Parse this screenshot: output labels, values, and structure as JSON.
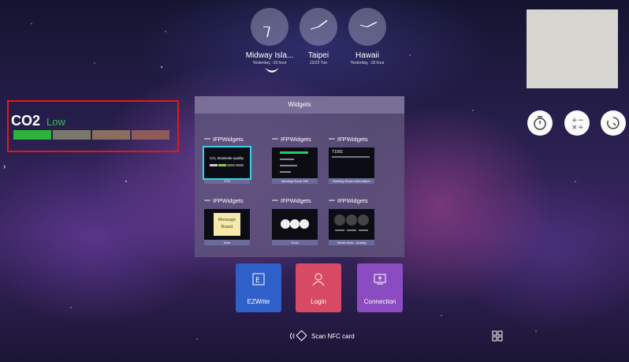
{
  "clocks": [
    {
      "city": "Midway Isla...",
      "sub": "Yesterday, -19 hour"
    },
    {
      "city": "Taipei",
      "sub": "12/22 Tue"
    },
    {
      "city": "Hawaii",
      "sub": "Yesterday, -18 hour"
    }
  ],
  "co2_widget": {
    "title": "CO2",
    "level": "Low",
    "level_color": "#35c24a"
  },
  "widgets_panel": {
    "title": "Widgets",
    "items": [
      {
        "source": "IFPWidgets",
        "caption": "CO2",
        "preview_text": "CO₂ Moderate quality"
      },
      {
        "source": "IFPWidgets",
        "caption": "Meeting Room 365"
      },
      {
        "source": "IFPWidgets",
        "caption": "Meeting Room Information",
        "preview_text": "T1001"
      },
      {
        "source": "IFPWidgets",
        "caption": "Note",
        "preview_text": "Message Board"
      },
      {
        "source": "IFPWidgets",
        "caption": "Tools"
      },
      {
        "source": "IFPWidgets",
        "caption": "World clock - Analog"
      }
    ]
  },
  "tiles": [
    {
      "label": "EZWrite",
      "color": "#2f5fc8"
    },
    {
      "label": "Login",
      "color": "#d64a64"
    },
    {
      "label": "Connection",
      "color": "#8a4cc0"
    }
  ],
  "nfc": {
    "label": "Scan NFC card"
  },
  "colors": {
    "highlight_border": "#e0181e",
    "selected_widget": "#3ad0e8"
  },
  "icons": [
    "timer-icon",
    "calculator-icon",
    "countdown-icon",
    "apps-grid-icon",
    "nfc-icon",
    "moon-icon"
  ]
}
